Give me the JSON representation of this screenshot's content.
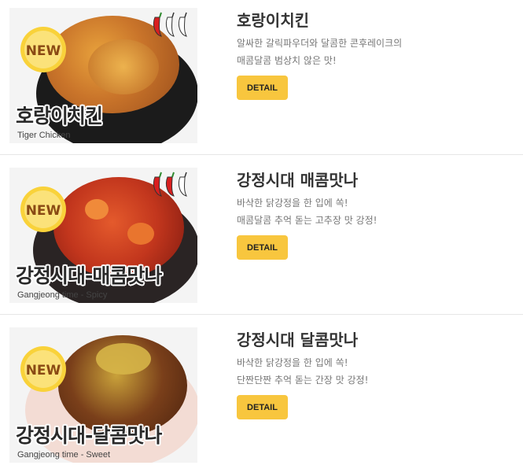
{
  "menu": {
    "items": [
      {
        "badge": "NEW",
        "thumb_title": "호랑이치킨",
        "thumb_subtitle": "Tiger Chicken",
        "name": "호랑이치킨",
        "desc_lines": [
          "알싸한 갈릭파우더와 달콤한 콘후레이크의",
          "매콤달콤 범상치 않은 맛!"
        ],
        "button_label": "DETAIL",
        "pepper_icon": "pepper-icon",
        "spice_level": 1,
        "spice_max": 3
      },
      {
        "badge": "NEW",
        "thumb_title": "강정시대-매콤맛나",
        "thumb_subtitle": "Gangjeong time - Spicy",
        "name": "강정시대 매콤맛나",
        "desc_lines": [
          "바삭한 닭강정을 한 입에 쏙!",
          "매콤달콤 추억 돋는 고추장 맛 강정!"
        ],
        "button_label": "DETAIL",
        "pepper_icon": "pepper-icon",
        "spice_level": 2,
        "spice_max": 3
      },
      {
        "badge": "NEW",
        "thumb_title": "강정시대-달콤맛나",
        "thumb_subtitle": "Gangjeong time - Sweet",
        "name": "강정시대 달콤맛나",
        "desc_lines": [
          "바삭한 닭강정을 한 입에 쏙!",
          "단짠단짠 추억 돋는 간장 맛 강정!"
        ],
        "button_label": "DETAIL"
      }
    ]
  },
  "colors": {
    "button_bg": "#f8c63e",
    "badge_yellow": "#f9d23a",
    "pepper_red": "#d81f1f",
    "divider": "#e6e6e6"
  }
}
